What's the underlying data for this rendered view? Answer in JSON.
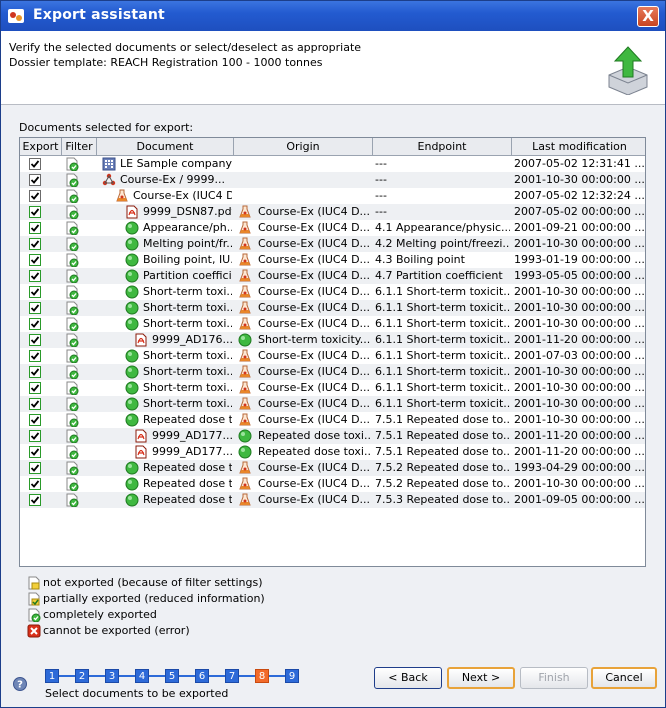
{
  "window": {
    "title": "Export assistant",
    "close_label": "X"
  },
  "header": {
    "line1": "Verify the selected documents or select/deselect as appropriate",
    "line2": "Dossier template: REACH Registration 100 - 1000 tonnes"
  },
  "section_label": "Documents selected for export:",
  "table": {
    "columns": [
      "Export",
      "Filter",
      "Document",
      "Origin",
      "Endpoint",
      "Last modification"
    ],
    "rows": [
      {
        "indent": 0,
        "icon": "company-icon",
        "doc": "LE Sample company",
        "origin_icon": "",
        "origin": "",
        "endpoint": "---",
        "modified": "2007-05-02 12:31:41 ...",
        "check": "black"
      },
      {
        "indent": 0,
        "icon": "substance-icon",
        "doc": "Course-Ex / 9999...",
        "origin_icon": "",
        "origin": "",
        "endpoint": "---",
        "modified": "2001-10-30 00:00:00 ...",
        "check": "black"
      },
      {
        "indent": 1,
        "icon": "flask-icon",
        "doc": "Course-Ex (IUC4 D...",
        "origin_icon": "",
        "origin": "",
        "endpoint": "---",
        "modified": "2007-05-02 12:32:24 ...",
        "check": "black"
      },
      {
        "indent": 2,
        "icon": "pdf-icon",
        "doc": "9999_DSN87.pdf...",
        "origin_icon": "flask-icon",
        "origin": "Course-Ex (IUC4 D...",
        "endpoint": "---",
        "modified": "2007-05-02 00:00:00 ...",
        "check": "green"
      },
      {
        "indent": 2,
        "icon": "green-dot-icon",
        "doc": "Appearance/ph...",
        "origin_icon": "flask-icon",
        "origin": "Course-Ex (IUC4 D...",
        "endpoint": "4.1 Appearance/physic...",
        "modified": "2001-09-21 00:00:00 ...",
        "check": "green"
      },
      {
        "indent": 2,
        "icon": "green-dot-icon",
        "doc": "Melting point/fr...",
        "origin_icon": "flask-icon",
        "origin": "Course-Ex (IUC4 D...",
        "endpoint": "4.2 Melting point/freezi...",
        "modified": "2001-10-30 00:00:00 ...",
        "check": "green"
      },
      {
        "indent": 2,
        "icon": "green-dot-icon",
        "doc": "Boiling point, IU...",
        "origin_icon": "flask-icon",
        "origin": "Course-Ex (IUC4 D...",
        "endpoint": "4.3 Boiling point",
        "modified": "1993-01-19 00:00:00 ...",
        "check": "green"
      },
      {
        "indent": 2,
        "icon": "green-dot-icon",
        "doc": "Partition coeffici...",
        "origin_icon": "flask-icon",
        "origin": "Course-Ex (IUC4 D...",
        "endpoint": "4.7 Partition coefficient",
        "modified": "1993-05-05 00:00:00 ...",
        "check": "green"
      },
      {
        "indent": 2,
        "icon": "green-dot-icon",
        "doc": "Short-term toxi...",
        "origin_icon": "flask-icon",
        "origin": "Course-Ex (IUC4 D...",
        "endpoint": "6.1.1 Short-term toxicit...",
        "modified": "2001-10-30 00:00:00 ...",
        "check": "green"
      },
      {
        "indent": 2,
        "icon": "green-dot-icon",
        "doc": "Short-term toxi...",
        "origin_icon": "flask-icon",
        "origin": "Course-Ex (IUC4 D...",
        "endpoint": "6.1.1 Short-term toxicit...",
        "modified": "2001-10-30 00:00:00 ...",
        "check": "green"
      },
      {
        "indent": 2,
        "icon": "green-dot-icon",
        "doc": "Short-term toxi...",
        "origin_icon": "flask-icon",
        "origin": "Course-Ex (IUC4 D...",
        "endpoint": "6.1.1 Short-term toxicit...",
        "modified": "2001-10-30 00:00:00 ...",
        "check": "green"
      },
      {
        "indent": 3,
        "icon": "pdf-icon",
        "doc": "9999_AD176...",
        "origin_icon": "green-dot-icon",
        "origin": "Short-term toxicity...",
        "endpoint": "6.1.1 Short-term toxicit...",
        "modified": "2001-11-20 00:00:00 ...",
        "check": "green"
      },
      {
        "indent": 2,
        "icon": "green-dot-icon",
        "doc": "Short-term toxi...",
        "origin_icon": "flask-icon",
        "origin": "Course-Ex (IUC4 D...",
        "endpoint": "6.1.1 Short-term toxicit...",
        "modified": "2001-07-03 00:00:00 ...",
        "check": "green"
      },
      {
        "indent": 2,
        "icon": "green-dot-icon",
        "doc": "Short-term toxi...",
        "origin_icon": "flask-icon",
        "origin": "Course-Ex (IUC4 D...",
        "endpoint": "6.1.1 Short-term toxicit...",
        "modified": "2001-10-30 00:00:00 ...",
        "check": "green"
      },
      {
        "indent": 2,
        "icon": "green-dot-icon",
        "doc": "Short-term toxi...",
        "origin_icon": "flask-icon",
        "origin": "Course-Ex (IUC4 D...",
        "endpoint": "6.1.1 Short-term toxicit...",
        "modified": "2001-10-30 00:00:00 ...",
        "check": "green"
      },
      {
        "indent": 2,
        "icon": "green-dot-icon",
        "doc": "Short-term toxi...",
        "origin_icon": "flask-icon",
        "origin": "Course-Ex (IUC4 D...",
        "endpoint": "6.1.1 Short-term toxicit...",
        "modified": "2001-10-30 00:00:00 ...",
        "check": "green"
      },
      {
        "indent": 2,
        "icon": "green-dot-icon",
        "doc": "Repeated dose t...",
        "origin_icon": "flask-icon",
        "origin": "Course-Ex (IUC4 D...",
        "endpoint": "7.5.1 Repeated dose to...",
        "modified": "2001-10-30 00:00:00 ...",
        "check": "green"
      },
      {
        "indent": 3,
        "icon": "pdf-icon",
        "doc": "9999_AD177...",
        "origin_icon": "green-dot-icon",
        "origin": "Repeated dose toxi...",
        "endpoint": "7.5.1 Repeated dose to...",
        "modified": "2001-11-20 00:00:00 ...",
        "check": "green"
      },
      {
        "indent": 3,
        "icon": "pdf-icon",
        "doc": "9999_AD177...",
        "origin_icon": "green-dot-icon",
        "origin": "Repeated dose toxi...",
        "endpoint": "7.5.1 Repeated dose to...",
        "modified": "2001-11-20 00:00:00 ...",
        "check": "green"
      },
      {
        "indent": 2,
        "icon": "green-dot-icon",
        "doc": "Repeated dose t...",
        "origin_icon": "flask-icon",
        "origin": "Course-Ex (IUC4 D...",
        "endpoint": "7.5.2 Repeated dose to...",
        "modified": "1993-04-29 00:00:00 ...",
        "check": "green"
      },
      {
        "indent": 2,
        "icon": "green-dot-icon",
        "doc": "Repeated dose t...",
        "origin_icon": "flask-icon",
        "origin": "Course-Ex (IUC4 D...",
        "endpoint": "7.5.2 Repeated dose to...",
        "modified": "2001-10-30 00:00:00 ...",
        "check": "green"
      },
      {
        "indent": 2,
        "icon": "green-dot-icon",
        "doc": "Repeated dose t...",
        "origin_icon": "flask-icon",
        "origin": "Course-Ex (IUC4 D...",
        "endpoint": "7.5.3 Repeated dose to...",
        "modified": "2001-09-05 00:00:00 ...",
        "check": "green"
      }
    ]
  },
  "legend": [
    {
      "icon": "not-exported-icon",
      "text": "not exported (because of filter settings)"
    },
    {
      "icon": "partially-exported-icon",
      "text": "partially exported (reduced information)"
    },
    {
      "icon": "completely-exported-icon",
      "text": "completely exported"
    },
    {
      "icon": "error-icon",
      "text": "cannot be exported (error)"
    }
  ],
  "wizard": {
    "steps": [
      "1",
      "2",
      "3",
      "4",
      "5",
      "6",
      "7",
      "8",
      "9"
    ],
    "active_step": "8",
    "caption": "Select documents to be exported"
  },
  "buttons": {
    "back": "< Back",
    "next": "Next >",
    "finish": "Finish",
    "cancel": "Cancel"
  },
  "colors": {
    "titlebar": "#235bd0",
    "accent_step": "#f26a2a",
    "check_green": "#2a9a2a"
  }
}
